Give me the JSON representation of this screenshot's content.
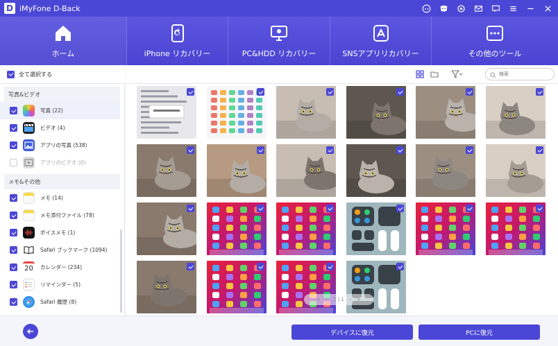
{
  "window": {
    "logo": "D",
    "title": "iMyFone D-Back",
    "icons": [
      "discord-icon",
      "discord-chat-icon",
      "settings-icon",
      "mail-icon",
      "feedback-icon",
      "menu-icon",
      "minimize-icon",
      "close-icon"
    ]
  },
  "nav": {
    "tabs": [
      {
        "label": "ホーム",
        "icon": "home-icon",
        "active": true
      },
      {
        "label": "iPhone リカバリー",
        "icon": "iphone-recovery-icon"
      },
      {
        "label": "PC&HDD リカバリー",
        "icon": "pc-recovery-icon"
      },
      {
        "label": "SNSアプリリカバリー",
        "icon": "app-store-icon"
      },
      {
        "label": "その他のツール",
        "icon": "more-tools-icon"
      }
    ]
  },
  "select_all": {
    "label": "全て選択する",
    "checked": true
  },
  "sidebar": {
    "groups": [
      {
        "title": "写真&ビデオ",
        "items": [
          {
            "label": "写真 (22)",
            "checked": true,
            "icon": "photos-icon",
            "active": true
          },
          {
            "label": "ビデオ (4)",
            "checked": true,
            "icon": "videos-icon"
          },
          {
            "label": "アプリの写真 (538)",
            "checked": true,
            "icon": "app-photos-icon"
          },
          {
            "label": "アプリのビデオ (0)",
            "checked": false,
            "icon": "app-videos-icon"
          }
        ]
      },
      {
        "title": "メモ&その他",
        "items": [
          {
            "label": "メモ (14)",
            "checked": true,
            "icon": "notes-icon"
          },
          {
            "label": "メモ添付ファイル (78)",
            "checked": true,
            "icon": "notes-attachment-icon"
          },
          {
            "label": "ボイスメモ (1)",
            "checked": true,
            "icon": "voice-memo-icon"
          },
          {
            "label": "Safari ブックマーク (1094)",
            "checked": true,
            "icon": "bookmark-icon"
          },
          {
            "label": "カレンダー (234)",
            "checked": true,
            "icon": "calendar-icon",
            "icon_text": "20"
          },
          {
            "label": "リマインダー (5)",
            "checked": true,
            "icon": "reminders-icon"
          },
          {
            "label": "Safari 履歴 (8)",
            "checked": true,
            "icon": "safari-icon"
          }
        ]
      }
    ]
  },
  "toolbar": {
    "icons": [
      "grid-view-icon",
      "folder-view-icon",
      "filter-icon"
    ],
    "search_placeholder": "検索"
  },
  "grid": {
    "thumbnails": [
      {
        "kind": "screenshot-settings",
        "checked": true
      },
      {
        "kind": "screenshot-control",
        "checked": true
      },
      {
        "kind": "cat-photo",
        "checked": true
      },
      {
        "kind": "cat-photo",
        "checked": true
      },
      {
        "kind": "cat-photo",
        "checked": true
      },
      {
        "kind": "cat-photo",
        "checked": true
      },
      {
        "kind": "cat-photo",
        "checked": true
      },
      {
        "kind": "cat-photo",
        "checked": true
      },
      {
        "kind": "cat-photo",
        "checked": true
      },
      {
        "kind": "cat-photo",
        "checked": true
      },
      {
        "kind": "cat-photo",
        "checked": true
      },
      {
        "kind": "cat-photo",
        "checked": true
      },
      {
        "kind": "cat-photo",
        "checked": true
      },
      {
        "kind": "ios-home-screen",
        "checked": true
      },
      {
        "kind": "ios-home-screen",
        "checked": true
      },
      {
        "kind": "ios-control-center",
        "checked": true
      },
      {
        "kind": "ios-home-screen",
        "checked": true
      },
      {
        "kind": "ios-home-screen",
        "checked": true
      },
      {
        "kind": "cat-photo",
        "checked": true
      },
      {
        "kind": "ios-home-screen",
        "checked": true
      },
      {
        "kind": "ios-home-screen",
        "checked": true
      },
      {
        "kind": "ios-control-center",
        "checked": true
      }
    ],
    "pager": {
      "first": "«",
      "prev": "‹",
      "text": "1 / 1",
      "next": "›",
      "last": "»"
    }
  },
  "bottom": {
    "back_icon": "arrow-left-icon",
    "restore_device_label": "デバイスに復元",
    "restore_pc_label": "PCに復元"
  },
  "colors": {
    "accent": "#4b47d6",
    "nav_top": "#5b55e0",
    "nav_bottom": "#4a44d2"
  }
}
